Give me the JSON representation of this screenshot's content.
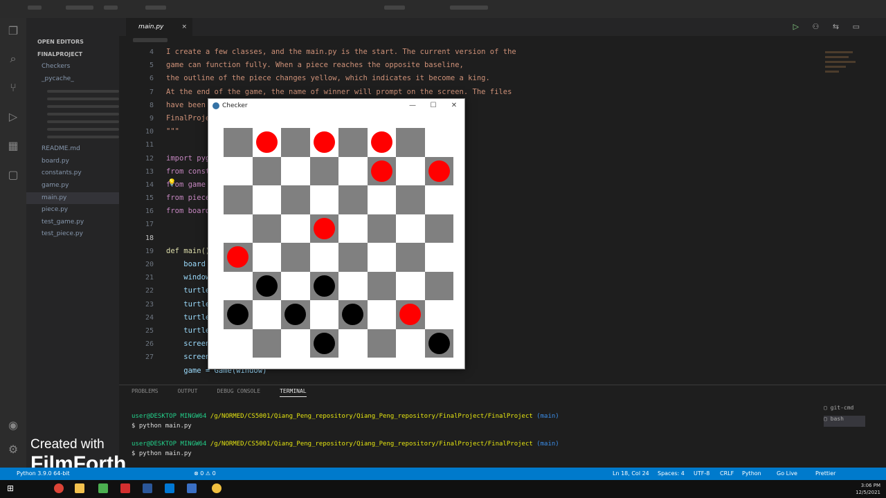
{
  "vscode": {
    "explorer": {
      "open_editors": "OPEN EDITORS",
      "project": "FINALPROJECT",
      "items": [
        {
          "label": "Checkers",
          "sel": false
        },
        {
          "label": "_pycache_",
          "sel": false
        },
        {
          "label": "",
          "sel": false
        },
        {
          "label": "",
          "sel": false
        },
        {
          "label": "",
          "sel": false
        },
        {
          "label": "",
          "sel": false
        },
        {
          "label": "",
          "sel": false
        },
        {
          "label": "",
          "sel": false
        },
        {
          "label": "",
          "sel": false
        },
        {
          "label": "README.md",
          "sel": false
        },
        {
          "label": "board.py",
          "sel": false
        },
        {
          "label": "constants.py",
          "sel": false
        },
        {
          "label": "game.py",
          "sel": false
        },
        {
          "label": "main.py",
          "sel": true
        },
        {
          "label": "piece.py",
          "sel": false
        },
        {
          "label": "test_game.py",
          "sel": false
        },
        {
          "label": "test_piece.py",
          "sel": false
        }
      ]
    },
    "tab": {
      "label": "main.py",
      "close": "×"
    },
    "gutter": [
      "4",
      "5",
      "6",
      "7",
      "8",
      "9",
      "10",
      "11",
      "12",
      "13",
      "14",
      "15",
      "16",
      "17",
      "18",
      "19",
      "20",
      "21",
      "22",
      "23",
      "24",
      "25",
      "26",
      "27"
    ],
    "code_lines": [
      {
        "cls": "str",
        "text": "I create a few classes, and the main.py is the start. The current version of the"
      },
      {
        "cls": "str",
        "text": "game can function fully. When a piece reaches the opposite baseline,"
      },
      {
        "cls": "str",
        "text": "the outline of the piece changes yellow, which indicates it become a king."
      },
      {
        "cls": "str",
        "text": "At the end of the game, the name of winner will prompt on the screen. The files"
      },
      {
        "cls": "str",
        "text": "have been uploaded to my github Qiang_Peng_repository"
      },
      {
        "cls": "str",
        "text": "FinalProject"
      },
      {
        "cls": "str",
        "text": "\"\"\""
      },
      {
        "cls": "",
        "text": ""
      },
      {
        "cls": "kw",
        "text": "import pygame"
      },
      {
        "cls": "kw",
        "text": "from constants import WIDTH, HEIGHT"
      },
      {
        "cls": "kw",
        "text": "from game import Game"
      },
      {
        "cls": "kw",
        "text": "from piece import Piece"
      },
      {
        "cls": "kw",
        "text": "from board import Board"
      },
      {
        "cls": "",
        "text": ""
      },
      {
        "cls": "",
        "text": ""
      },
      {
        "cls": "fn",
        "text": "def main():"
      },
      {
        "cls": "var",
        "text": "    board = Board()"
      },
      {
        "cls": "var",
        "text": "    window = pygame.display.set_mode((WIDTH, HEIGHT))"
      },
      {
        "cls": "var",
        "text": "    turtle = Turtle()"
      },
      {
        "cls": "var",
        "text": "    turtle.hideturtle()"
      },
      {
        "cls": "var",
        "text": "    turtle.penup()"
      },
      {
        "cls": "var",
        "text": "    turtle.speed(0)"
      },
      {
        "cls": "var",
        "text": "    screen = turtle.getscreen()"
      },
      {
        "cls": "var",
        "text": "    screen.bgcolor('white')"
      },
      {
        "cls": "var",
        "text": "    game = Game(window)"
      }
    ],
    "panel": {
      "tabs": [
        "PROBLEMS",
        "OUTPUT",
        "DEBUG CONSOLE",
        "TERMINAL"
      ],
      "active_tab": "TERMINAL",
      "shell_options": [
        "git-cmd",
        "bash"
      ],
      "line1_user": "user@DESKTOP MINGW64",
      "line1_path": "/g/NORMED/CS5001/Qiang_Peng_repository/Qiang_Peng_repository/FinalProject/FinalProject",
      "line1_branch": "(main)",
      "line2": "$ python main.py",
      "line3_user": "user@DESKTOP MINGW64",
      "line3_path": "/g/NORMED/CS5001/Qiang_Peng_repository/Qiang_Peng_repository/FinalProject/FinalProject",
      "line3_branch": "(main)",
      "line4": "$ python main.py"
    },
    "status": {
      "left": "Python 3.9.0 64-bit",
      "problems": "⊗ 0 ⚠ 0",
      "position": "Ln 18, Col 24",
      "spaces": "Spaces: 4",
      "encoding": "UTF-8",
      "eol": "CRLF",
      "language": "Python",
      "live": "Go Live",
      "prettier": "Prettier"
    },
    "clock": {
      "time": "3:06 PM",
      "date": "12/5/2021"
    }
  },
  "watermark": {
    "line1": "Created with",
    "line2": "FilmForth"
  },
  "checker_window": {
    "title": "Checker",
    "minimize": "—",
    "maximize": "☐",
    "close": "✕",
    "colors": {
      "dark": "#808080",
      "light": "#ffffff",
      "red": "#ff0000",
      "black": "#000000"
    },
    "board": [
      [
        ".",
        "r",
        ".",
        "r",
        ".",
        "r",
        ".",
        "."
      ],
      [
        ".",
        ".",
        ".",
        ".",
        ".",
        "r",
        ".",
        "r"
      ],
      [
        ".",
        ".",
        ".",
        ".",
        ".",
        ".",
        ".",
        "."
      ],
      [
        ".",
        ".",
        ".",
        "r",
        ".",
        ".",
        ".",
        "."
      ],
      [
        "r",
        ".",
        ".",
        ".",
        ".",
        ".",
        ".",
        "."
      ],
      [
        ".",
        "b",
        ".",
        "b",
        ".",
        ".",
        ".",
        "."
      ],
      [
        "b",
        ".",
        "b",
        ".",
        "b",
        ".",
        "r",
        "."
      ],
      [
        ".",
        ".",
        ".",
        "b",
        ".",
        ".",
        ".",
        "b"
      ]
    ]
  }
}
